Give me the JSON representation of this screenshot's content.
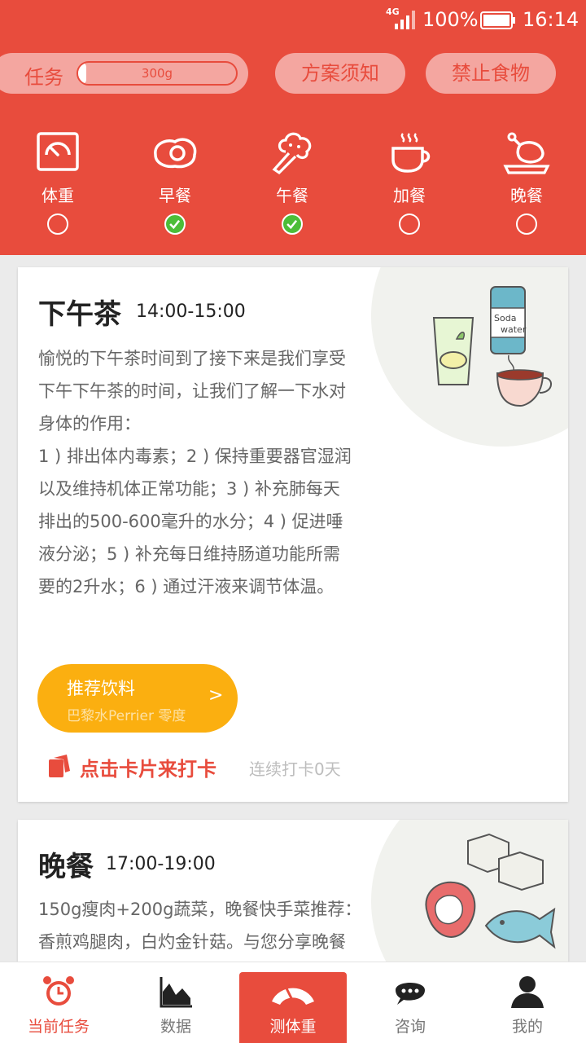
{
  "status_bar": {
    "network": "4G",
    "battery": "100%",
    "time": "16:14"
  },
  "header": {
    "task_label": "任务",
    "task_value": "300g",
    "task_progress": 0.05,
    "btn_plan_notice": "方案须知",
    "btn_forbidden_food": "禁止食物"
  },
  "steps": [
    {
      "label": "体重",
      "done": false,
      "icon": "scale-icon"
    },
    {
      "label": "早餐",
      "done": true,
      "icon": "fried-egg-icon"
    },
    {
      "label": "午餐",
      "done": true,
      "icon": "broccoli-icon"
    },
    {
      "label": "加餐",
      "done": false,
      "icon": "coffee-cup-icon"
    },
    {
      "label": "晚餐",
      "done": false,
      "icon": "roast-chicken-icon"
    }
  ],
  "card_tea": {
    "title": "下午茶",
    "time": "14:00-15:00",
    "desc_lines": [
      "愉悦的下午茶时间到了接下来是我们享受",
      "下午下午茶的时间，让我们了解一下水对",
      "身体的作用：",
      "1 ) 排出体内毒素；2 ) 保持重要器官湿润",
      "以及维持机体正常功能；3 ) 补充肺每天",
      "排出的500-600毫升的水分；4 ) 促进唾",
      "液分泌；5 ) 补充每日维持肠道功能所需",
      "要的2升水；6 ) 通过汗液来调节体温。"
    ],
    "drink_title": "推荐饮料",
    "drink_sub": "巴黎水Perrier 零度",
    "drink_arrow": ">",
    "checkin_label": "点击卡片来打卡",
    "checkin_streak": "连续打卡0天",
    "illustration_text_1": "Soda",
    "illustration_text_2": "water"
  },
  "card_dinner": {
    "title": "晚餐",
    "time": "17:00-19:00",
    "desc_lines": [
      "150g瘦肉+200g蔬菜，晚餐快手菜推荐：",
      "香煎鸡腿肉，白灼金针菇。与您分享晚餐"
    ]
  },
  "tabbar": [
    {
      "label": "当前任务",
      "icon": "alarm-clock-icon",
      "active": true
    },
    {
      "label": "数据",
      "icon": "chart-icon",
      "active": false
    },
    {
      "label": "测体重",
      "icon": "scale-gauge-icon",
      "active": false
    },
    {
      "label": "咨询",
      "icon": "chat-bubble-icon",
      "active": false
    },
    {
      "label": "我的",
      "icon": "person-icon",
      "active": false
    }
  ],
  "colors": {
    "brand_red": "#e84c3d",
    "pill_pink": "#f4a6a0",
    "check_green": "#4cbd38",
    "drink_orange": "#fbaf10"
  }
}
